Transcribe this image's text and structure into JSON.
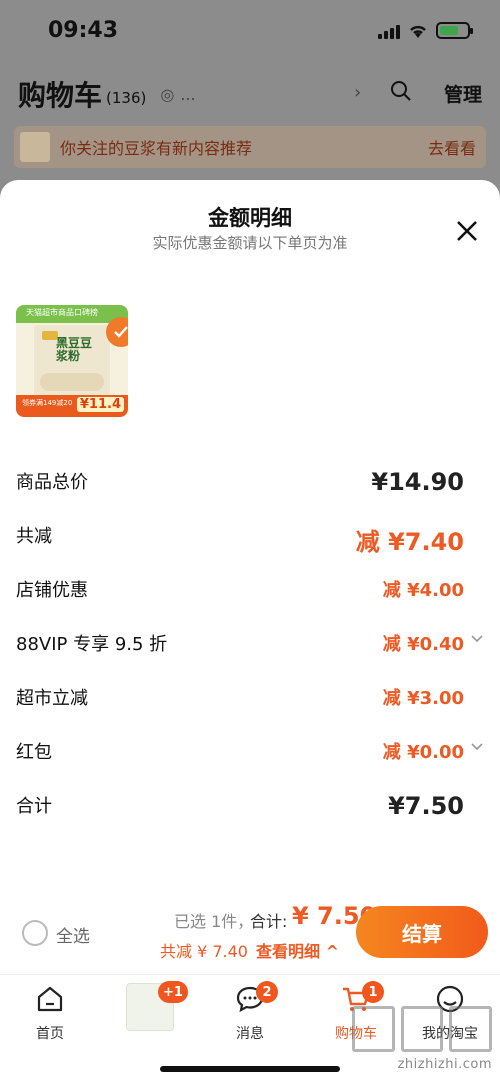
{
  "status_bar": {
    "time": "09:43"
  },
  "background": {
    "title": "购物车",
    "count": "(136)",
    "dots": "...",
    "manage_label": "管理",
    "notice_text": "你关注的豆浆有新内容推荐",
    "notice_link": "去看看"
  },
  "sheet": {
    "title": "金额明细",
    "subtitle": "实际优惠金额请以下单页为准",
    "product": {
      "banner": "天猫超市商品口碑榜",
      "name": "黑豆豆浆粉",
      "coupon": "领券满149减20",
      "price": "¥11.4"
    },
    "rows": [
      {
        "label": "商品总价",
        "value": "¥14.90"
      },
      {
        "label": "共减",
        "value": "减 ¥7.40"
      },
      {
        "label": "店铺优惠",
        "value": "减 ¥4.00"
      },
      {
        "label": "88VIP 专享 9.5 折",
        "value": "减 ¥0.40"
      },
      {
        "label": "超市立减",
        "value": "减 ¥3.00"
      },
      {
        "label": "红包",
        "value": "减 ¥0.00"
      },
      {
        "label": "合计",
        "value": "¥7.50"
      }
    ]
  },
  "action_bar": {
    "select_all": "全选",
    "selected": "已选 1件，",
    "total_label": "合计:",
    "total_value": "¥ 7.50",
    "discount": "共减 ¥ 7.40",
    "view_detail": "查看明细 ^",
    "checkout": "结算"
  },
  "tab_bar": {
    "home": "首页",
    "promo_badge": "+1",
    "messages": "消息",
    "messages_badge": "2",
    "cart": "购物车",
    "cart_badge": "1",
    "mine": "我的淘宝"
  },
  "watermark": "zhizhizhi.com",
  "colors": {
    "accent": "#ee5a23",
    "checkout_start": "#f5861f",
    "checkout_end": "#f25a1b"
  }
}
